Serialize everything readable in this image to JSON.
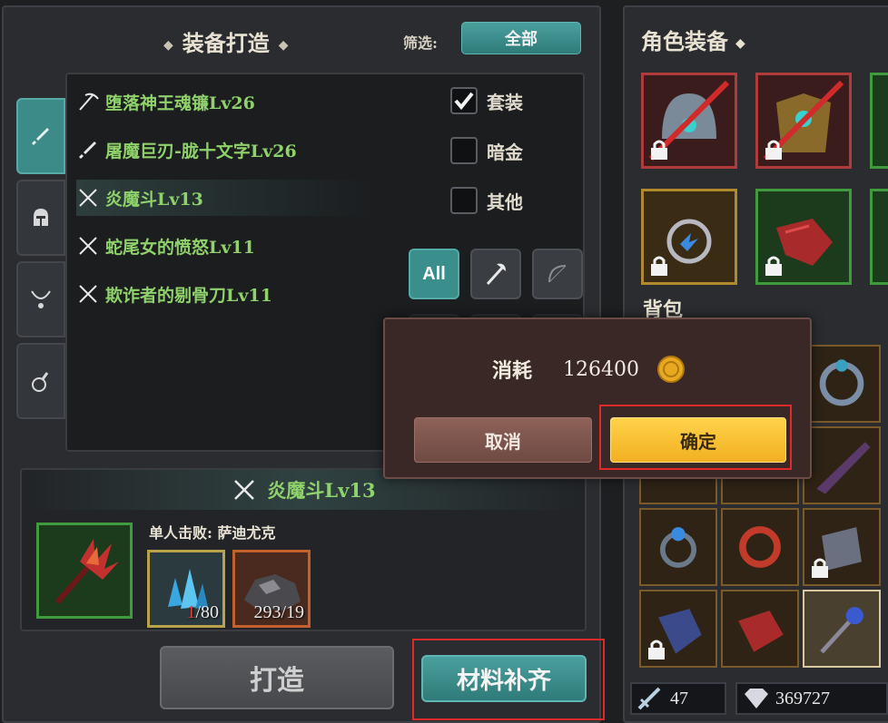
{
  "craft": {
    "title": "装备打造",
    "filter_label": "筛选:",
    "filter_value": "全部",
    "list": [
      {
        "name": "堕落神王魂镰Lv26",
        "icon": "scythe-icon"
      },
      {
        "name": "屠魔巨刃-胧十文字Lv26",
        "icon": "sword-icon"
      },
      {
        "name": "炎魔斗Lv13",
        "icon": "crossed-blades-icon",
        "selected": true
      },
      {
        "name": "蛇尾女的愤怒Lv11",
        "icon": "crossed-blades-icon"
      },
      {
        "name": "欺诈者的剔骨刀Lv11",
        "icon": "crossed-blades-icon"
      }
    ],
    "checks": [
      {
        "label": "套装",
        "checked": true
      },
      {
        "label": "暗金",
        "checked": false
      },
      {
        "label": "其他",
        "checked": false
      }
    ],
    "weapon_filter_all": "All",
    "selected_item": {
      "name": "炎魔斗Lv13",
      "source": "单人击败: 萨迪尤克",
      "materials": [
        {
          "count_have": "1",
          "count_need": "/80",
          "icon": "blue-crystal-icon"
        },
        {
          "count_text": "293/19",
          "icon": "ore-icon"
        }
      ]
    },
    "craft_button": "打造",
    "fill_button": "材料补齐"
  },
  "equipment": {
    "title": "角色装备",
    "bag_title": "背包"
  },
  "counters": {
    "weapon_points": "47",
    "gems": "369727"
  },
  "dialog": {
    "cost_label": "消耗",
    "cost_value": "126400",
    "cancel": "取消",
    "confirm": "确定"
  },
  "colors": {
    "teal": "#3a8f8d",
    "confirm_yellow": "#ffc835",
    "highlight_red": "#e02a2a",
    "item_green": "#8fd16a"
  }
}
